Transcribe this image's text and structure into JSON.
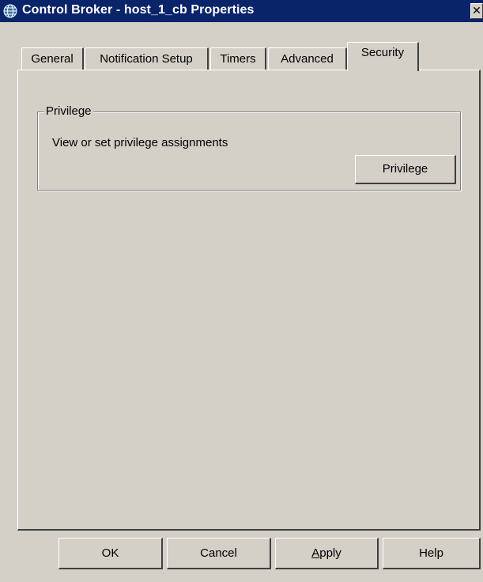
{
  "window": {
    "title": "Control Broker - host_1_cb Properties",
    "close_glyph": "✕",
    "icon": "globe-icon",
    "colors": {
      "titlebar": "#0a246a",
      "face": "#d4d0c8",
      "highlight": "#ffffff",
      "shadow": "#404040"
    }
  },
  "tabs": [
    {
      "label": "General",
      "active": false
    },
    {
      "label": "Notification Setup",
      "active": false
    },
    {
      "label": "Timers",
      "active": false
    },
    {
      "label": "Advanced",
      "active": false
    },
    {
      "label": "Security",
      "active": true
    }
  ],
  "privilege_group": {
    "legend": "Privilege",
    "description": "View or set privilege assignments",
    "button_label": "Privilege"
  },
  "footer": {
    "ok_label": "OK",
    "cancel_label": "Cancel",
    "apply_label_mnemonic": "A",
    "apply_label_rest": "pply",
    "help_label": "Help"
  }
}
